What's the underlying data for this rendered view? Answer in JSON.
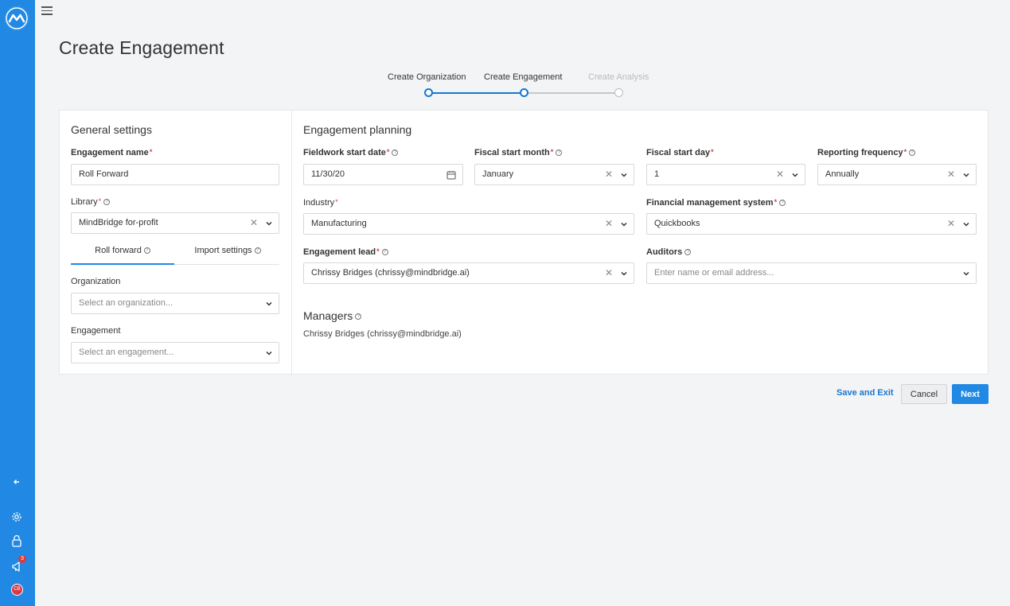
{
  "page": {
    "title": "Create Engagement"
  },
  "sidebar": {
    "notifications_count": "3",
    "avatar_initials": "CB"
  },
  "stepper": {
    "steps": [
      {
        "label": "Create Organization",
        "state": "done"
      },
      {
        "label": "Create Engagement",
        "state": "current"
      },
      {
        "label": "Create Analysis",
        "state": "inactive"
      }
    ]
  },
  "general": {
    "title": "General settings",
    "engagement_name": {
      "label": "Engagement name",
      "value": "Roll Forward"
    },
    "library": {
      "label": "Library",
      "value": "MindBridge for-profit"
    },
    "tabs": [
      {
        "label": "Roll forward"
      },
      {
        "label": "Import settings"
      }
    ],
    "organization": {
      "label": "Organization",
      "placeholder": "Select an organization..."
    },
    "engagement": {
      "label": "Engagement",
      "placeholder": "Select an engagement..."
    }
  },
  "planning": {
    "title": "Engagement planning",
    "fieldwork_start_date": {
      "label": "Fieldwork start date",
      "value": "11/30/20"
    },
    "fiscal_start_month": {
      "label": "Fiscal start month",
      "value": "January"
    },
    "fiscal_start_day": {
      "label": "Fiscal start day",
      "value": "1"
    },
    "reporting_frequency": {
      "label": "Reporting frequency",
      "value": "Annually"
    },
    "industry": {
      "label": "Industry",
      "value": "Manufacturing"
    },
    "financial_management_system": {
      "label": "Financial management system",
      "value": "Quickbooks"
    },
    "engagement_lead": {
      "label": "Engagement lead",
      "value": "Chrissy Bridges (chrissy@mindbridge.ai)"
    },
    "auditors": {
      "label": "Auditors",
      "placeholder": "Enter name or email address..."
    },
    "managers": {
      "label": "Managers",
      "value": "Chrissy Bridges (chrissy@mindbridge.ai)"
    }
  },
  "actions": {
    "save_exit": "Save and Exit",
    "cancel": "Cancel",
    "next": "Next"
  },
  "colors": {
    "accent": "#2189e3",
    "required": "#e03a3a"
  }
}
